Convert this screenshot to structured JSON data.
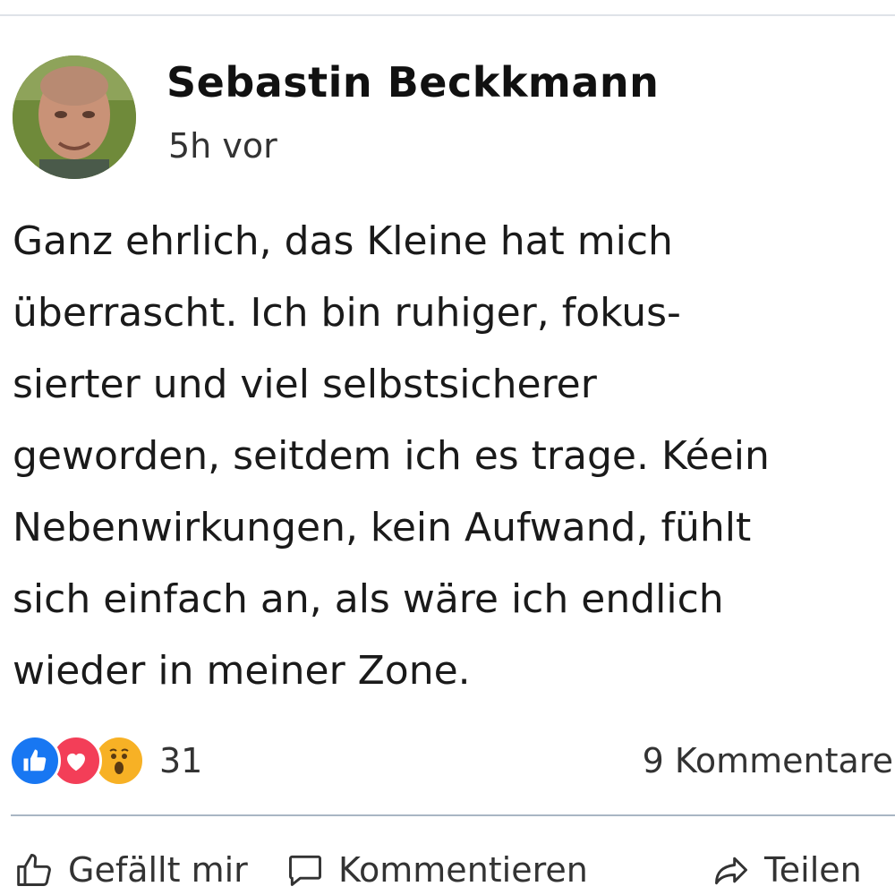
{
  "post": {
    "author": "Sebastin Beckkmann",
    "time": "5h vor",
    "lines": [
      "Ganz ehrlich, das Kleine hat mich",
      "überrascht. Ich bin ruhiger, fokus-",
      "sierter und viel selbstsicherer",
      "geworden, seitdem ich es trage. Kéein",
      "Nebenwirkungen, kein Aufwand, fühlt",
      "sich einfach an, als wäre ich endlich",
      "wieder in meiner Zone."
    ]
  },
  "stats": {
    "reaction_icons": [
      "like-icon",
      "love-icon",
      "wow-icon"
    ],
    "reactions_count": "31",
    "comments": "9 Kommentare"
  },
  "actions": {
    "like": "Gefällt mir",
    "comment": "Kommentieren",
    "share": "Teilen"
  },
  "colors": {
    "like": "#1877f2",
    "love": "#f33e58",
    "wow": "#f7b125",
    "divider": "#a9b6c4"
  }
}
